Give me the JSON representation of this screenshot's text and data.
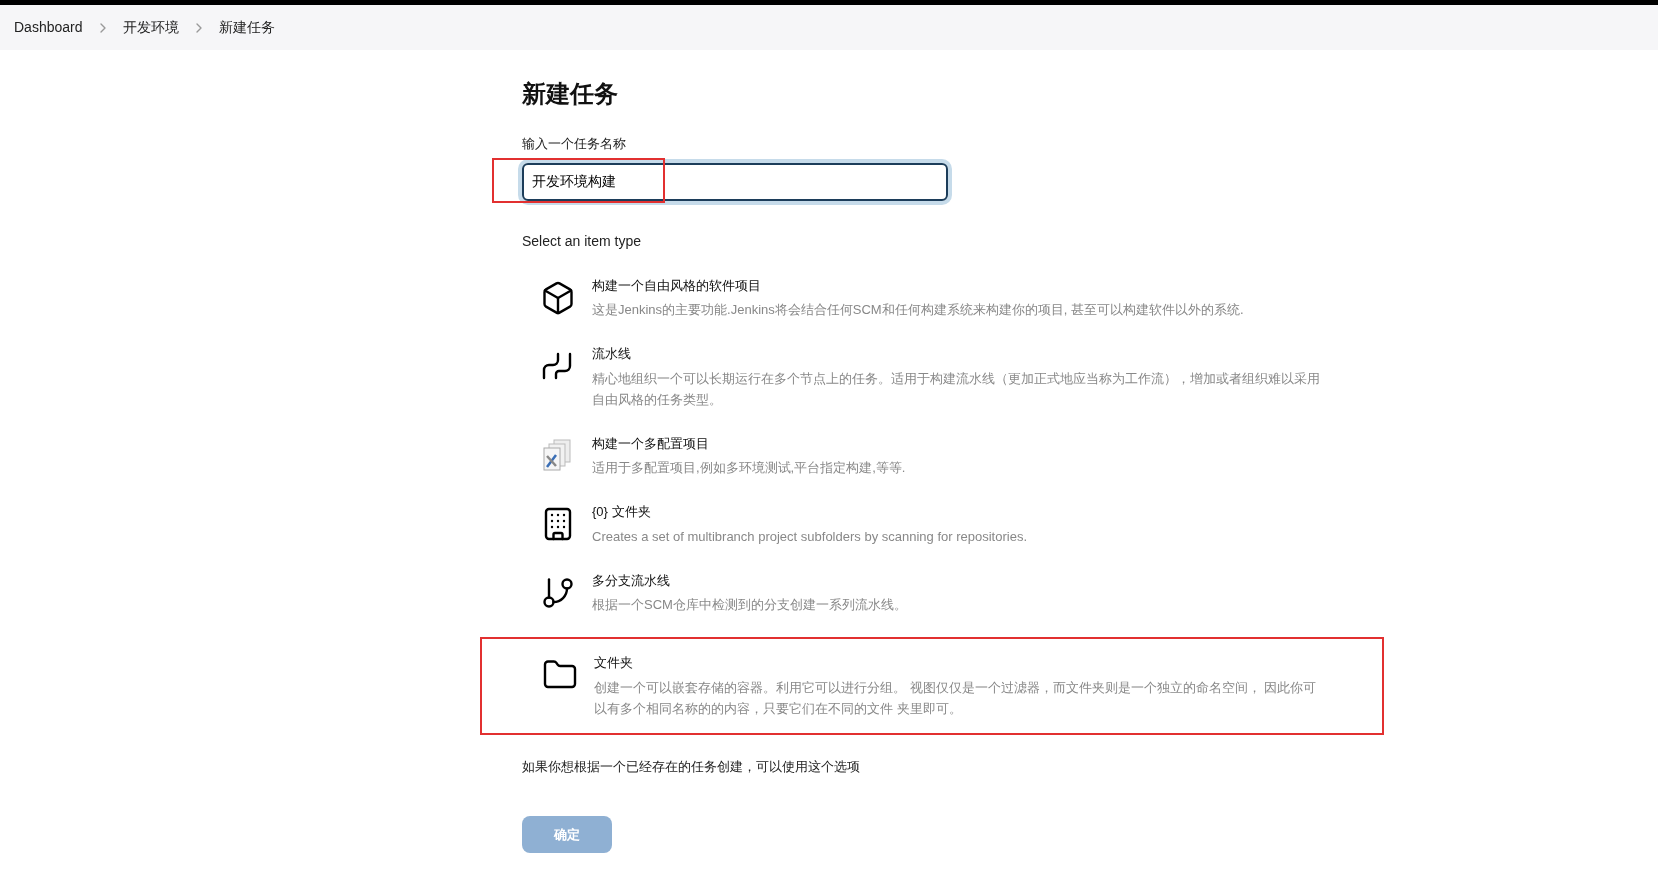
{
  "breadcrumb": [
    {
      "label": "Dashboard"
    },
    {
      "label": "开发环境"
    },
    {
      "label": "新建任务"
    }
  ],
  "title": "新建任务",
  "name_field": {
    "label": "输入一个任务名称",
    "value": "开发环境构建",
    "focused": true,
    "highlighted": true
  },
  "item_type_label": "Select an item type",
  "items": [
    {
      "kind": "cube",
      "title": "构建一个自由风格的软件项目",
      "description": "这是Jenkins的主要功能.Jenkins将会结合任何SCM和任何构建系统来构建你的项目, 甚至可以构建软件以外的系统.",
      "highlighted": false
    },
    {
      "kind": "pipeline",
      "title": "流水线",
      "description": "精心地组织一个可以长期运行在多个节点上的任务。适用于构建流水线（更加正式地应当称为工作流），增加或者组织难以采用自由风格的任务类型。",
      "highlighted": false
    },
    {
      "kind": "multiconfig",
      "title": "构建一个多配置项目",
      "description": "适用于多配置项目,例如多环境测试,平台指定构建,等等.",
      "highlighted": false
    },
    {
      "kind": "building",
      "title": "{0} 文件夹",
      "description": "Creates a set of multibranch project subfolders by scanning for repositories.",
      "highlighted": false
    },
    {
      "kind": "branch",
      "title": "多分支流水线",
      "description": "根据一个SCM仓库中检测到的分支创建一系列流水线。",
      "highlighted": false
    },
    {
      "kind": "folder",
      "title": "文件夹",
      "description": "创建一个可以嵌套存储的容器。利用它可以进行分组。 视图仅仅是一个过滤器，而文件夹则是一个独立的命名空间， 因此你可以有多个相同名称的的内容，只要它们在不同的文件 夹里即可。",
      "highlighted": true
    }
  ],
  "copy_hint": "如果你想根据一个已经存在的任务创建，可以使用这个选项",
  "ok_button": {
    "label": "确定",
    "disabled": true
  }
}
